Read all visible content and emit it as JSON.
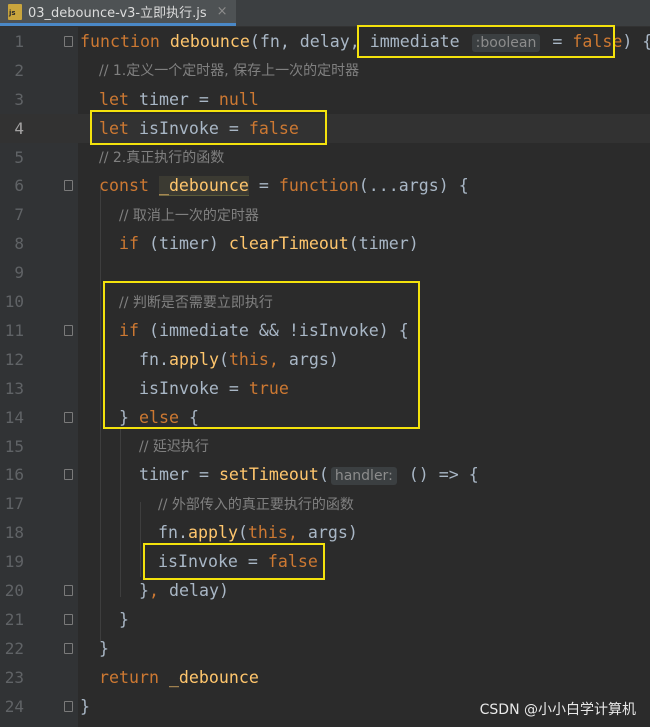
{
  "tab": {
    "title": "03_debounce-v3-立即执行.js",
    "close": "×",
    "icon": "js-file-icon"
  },
  "lines": [
    {
      "n": "1"
    },
    {
      "n": "2"
    },
    {
      "n": "3"
    },
    {
      "n": "4"
    },
    {
      "n": "5"
    },
    {
      "n": "6"
    },
    {
      "n": "7"
    },
    {
      "n": "8"
    },
    {
      "n": "9"
    },
    {
      "n": "10"
    },
    {
      "n": "11"
    },
    {
      "n": "12"
    },
    {
      "n": "13"
    },
    {
      "n": "14"
    },
    {
      "n": "15"
    },
    {
      "n": "16"
    },
    {
      "n": "17"
    },
    {
      "n": "18"
    },
    {
      "n": "19"
    },
    {
      "n": "20"
    },
    {
      "n": "21"
    },
    {
      "n": "22"
    },
    {
      "n": "23"
    },
    {
      "n": "24"
    }
  ],
  "code": {
    "l1": {
      "kw": "function",
      "name": " debounce",
      "rest1": "(fn, delay, ",
      "param": "immediate",
      "hint": ":boolean",
      "eq": " = ",
      "val": "false",
      "end": ") {"
    },
    "l2": {
      "comment": "// 1.定义一个定时器, 保存上一次的定时器"
    },
    "l3": {
      "kw": "let",
      "rest": " timer = ",
      "val": "null"
    },
    "l4": {
      "kw": "let",
      "rest": " isInvoke = ",
      "val": "false"
    },
    "l5": {
      "comment": "// 2.真正执行的函数"
    },
    "l6": {
      "kw": "const",
      "sp": " ",
      "name": "_debounce",
      "eq": " = ",
      "kw2": "function",
      "rest": "(...args) {"
    },
    "l7": {
      "comment": "// 取消上一次的定时器"
    },
    "l8": {
      "kw": "if",
      "rest1": " (timer) ",
      "fn": "clearTimeout",
      "rest2": "(timer)"
    },
    "l10": {
      "comment": "// 判断是否需要立即执行"
    },
    "l11": {
      "kw": "if",
      "rest": " (immediate && !isInvoke) {"
    },
    "l12": {
      "a": "fn.",
      "fn": "apply",
      "b": "(",
      "kw": "this,",
      "c": " args)"
    },
    "l13": {
      "a": "isInvoke = ",
      "val": "true"
    },
    "l14": {
      "a": "} ",
      "kw": "else",
      "b": " {"
    },
    "l15": {
      "comment": "// 延迟执行"
    },
    "l16": {
      "a": "timer = ",
      "fn": "setTimeout",
      "b": "(",
      "hint": "handler:",
      "c": " () => {"
    },
    "l17": {
      "comment": "// 外部传入的真正要执行的函数"
    },
    "l18": {
      "a": "fn.",
      "fn": "apply",
      "b": "(",
      "kw": "this,",
      "c": " args)"
    },
    "l19": {
      "a": "isInvoke = ",
      "val": "false"
    },
    "l20": {
      "a": "}",
      "kw": ",",
      "b": " delay)"
    },
    "l21": {
      "a": "}"
    },
    "l22": {
      "a": "}"
    },
    "l23": {
      "kw": "return",
      "name": " _debounce"
    },
    "l24": {
      "a": "}"
    }
  },
  "watermark": "CSDN @小小白学计算机",
  "colors": {
    "highlight_box": "#f4e20c",
    "background": "#2b2b2b",
    "keyword": "#cc7832",
    "function": "#ffc66d",
    "comment": "#808080"
  }
}
